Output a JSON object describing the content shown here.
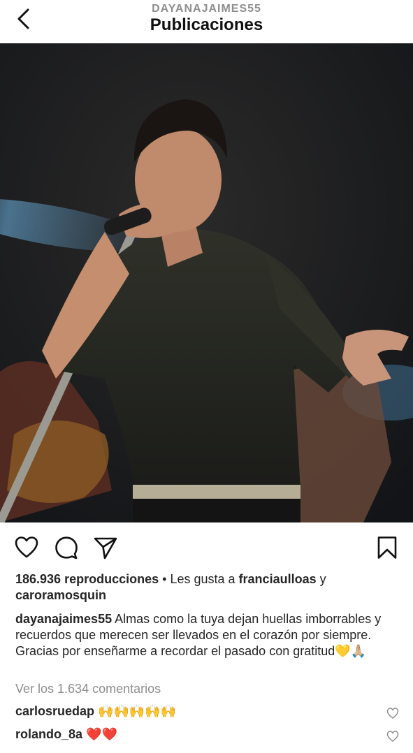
{
  "header": {
    "username": "DAYANAJAIMES55",
    "title": "Publicaciones"
  },
  "icons": {
    "back": "chevron-left-icon",
    "like": "heart-icon",
    "comment": "comment-icon",
    "share": "send-icon",
    "save": "bookmark-icon"
  },
  "stats": {
    "views": "186.936 reproducciones",
    "separator": "•",
    "liked_prefix": "Les gusta a",
    "liked_user_1": "franciaulloas",
    "liked_conj": "y",
    "liked_user_2": "caroramosquin"
  },
  "caption": {
    "username": "dayanajaimes55",
    "text": "Almas como la tuya dejan huellas imborrables y recuerdos que merecen ser llevados en el corazón por siempre. Gracias por enseñarme a recordar el pasado con gratitud💛🙏🏼"
  },
  "view_comments": "Ver los 1.634 comentarios",
  "comments": [
    {
      "username": "carlosruedap",
      "text": "🙌🙌🙌🙌🙌"
    },
    {
      "username": "rolando_8a",
      "text": "❤️❤️"
    }
  ],
  "colors": {
    "text": "#262626",
    "muted": "#8e8e8e",
    "heart": "#e0102c"
  }
}
